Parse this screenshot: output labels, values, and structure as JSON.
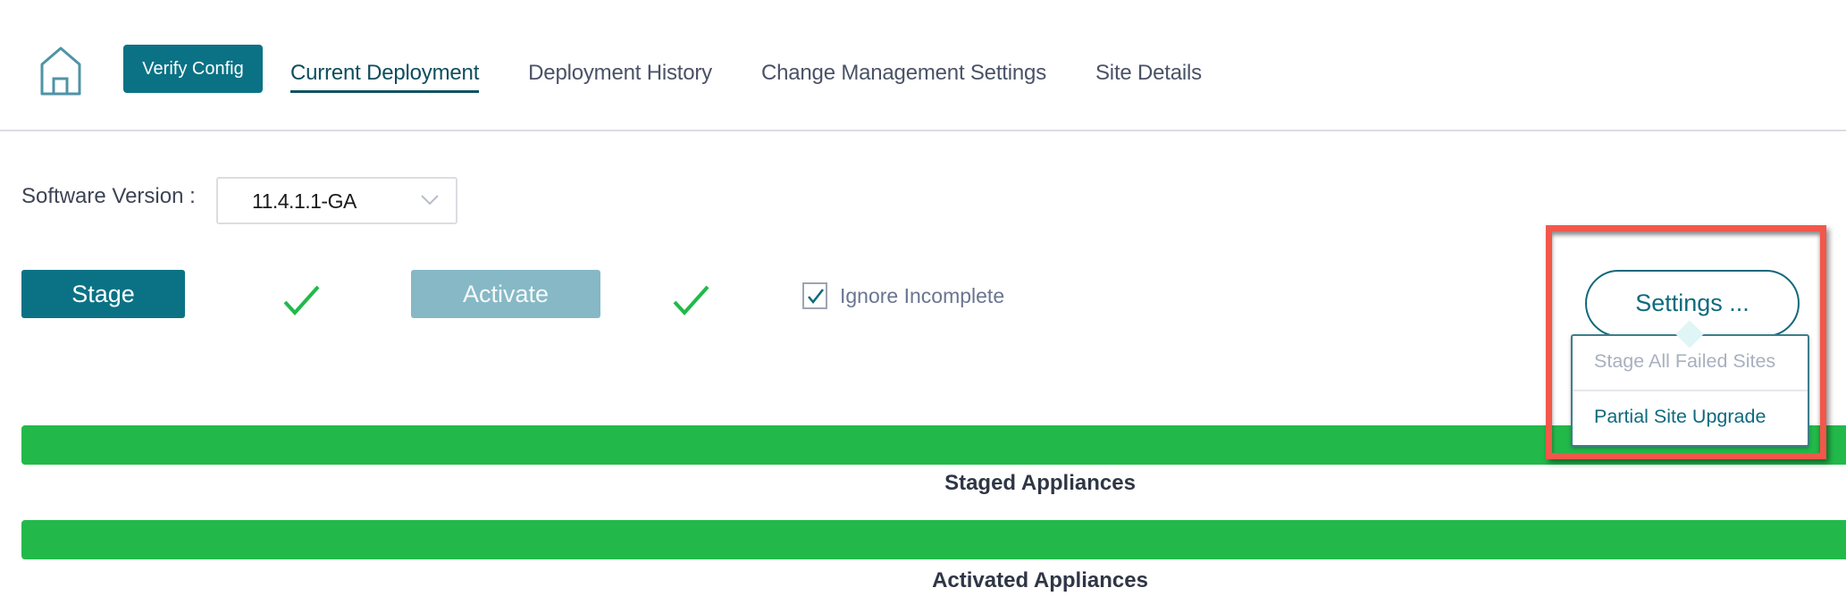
{
  "header": {
    "home_icon": "home-icon",
    "verify_config_label": "Verify Config",
    "tabs": [
      {
        "label": "Current Deployment",
        "active": true
      },
      {
        "label": "Deployment History",
        "active": false
      },
      {
        "label": "Change Management Settings",
        "active": false
      },
      {
        "label": "Site Details",
        "active": false
      }
    ]
  },
  "software_version": {
    "label": "Software Version :",
    "selected": "11.4.1.1-GA",
    "chevron_icon": "chevron-down-icon"
  },
  "actions": {
    "stage_label": "Stage",
    "stage_status_icon": "checkmark-icon",
    "activate_label": "Activate",
    "activate_enabled": false,
    "activate_status_icon": "checkmark-icon",
    "ignore_incomplete": {
      "label": "Ignore Incomplete",
      "checked": true
    }
  },
  "settings": {
    "button_label": "Settings ...",
    "menu_items": [
      {
        "label": "Stage All Failed Sites",
        "enabled": false
      },
      {
        "label": "Partial Site Upgrade",
        "enabled": true
      }
    ]
  },
  "progress": [
    {
      "label": "Staged Appliances",
      "percent": 100
    },
    {
      "label": "Activated Appliances",
      "percent": 100
    }
  ],
  "colors": {
    "primary": "#0b7285",
    "primary_disabled": "#86b9c5",
    "success": "#22b94a",
    "annotation": "#f2574a"
  }
}
